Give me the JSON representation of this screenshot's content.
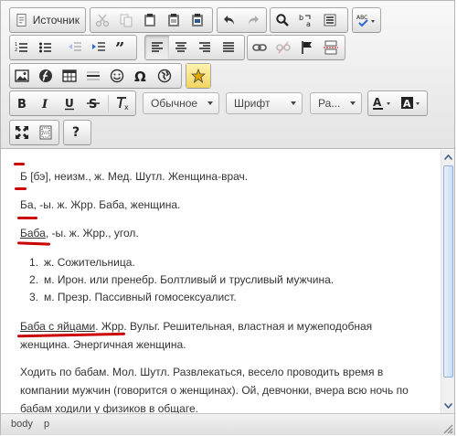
{
  "toolbar": {
    "source_label": "Источник",
    "style_combo": "Обычное",
    "font_combo": "Шрифт",
    "size_combo": "Ра...",
    "help_label": "?"
  },
  "content": {
    "line1": "Б [бэ], неизм., ж. Мед. Шутл. Женщина-врач.",
    "line2_head": "Ба",
    "line2_rest": ", -ы. ж. Жрр. Баба, женщина.",
    "line3_head": "Баба",
    "line3_rest": ", -ы. ж. Жрр., угол.",
    "list": [
      {
        "num": "1.",
        "text": "ж. Сожительница."
      },
      {
        "num": "2.",
        "text": "м. Ирон. или пренебр. Болтливый и трусливый мужчина."
      },
      {
        "num": "3.",
        "text": "м. Презр. Пассивный гомосексуалист."
      }
    ],
    "line4_head": "Баба с яйцами",
    "line4_rest": ". Жрр. Вульг. Решительная, властная и мужеподобная женщина. Энергичная женщина.",
    "line5": "Ходить по бабам. Мол. Шутл. Развлекаться, весело проводить время в компании мужчин (говорится о женщинах). Ой, девчонки, вчера всю ночь по бабам ходили у физиков в общаге."
  },
  "status": {
    "path1": "body",
    "path2": "p"
  },
  "colors": {
    "underline_mark": "#cc0000"
  }
}
